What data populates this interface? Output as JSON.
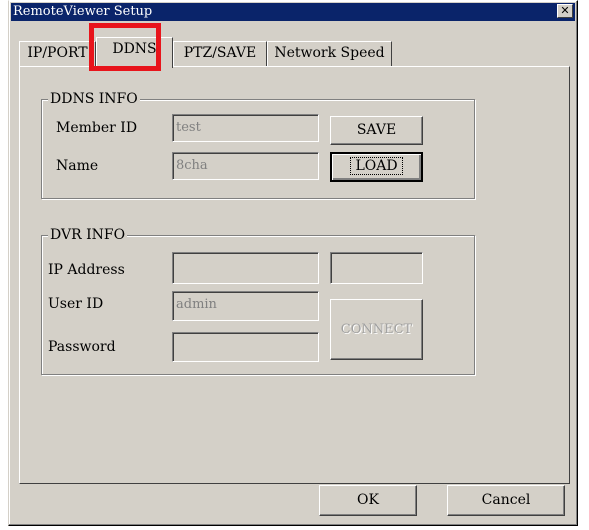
{
  "window": {
    "title": "RemoteViewer Setup",
    "close_symbol": "✕"
  },
  "tabs": [
    {
      "label": "IP/PORT",
      "active": false
    },
    {
      "label": "DDNS",
      "active": true
    },
    {
      "label": "PTZ/SAVE",
      "active": false
    },
    {
      "label": "Network Speed",
      "active": false
    }
  ],
  "ddns_info": {
    "title": "DDNS INFO",
    "member_id_label": "Member ID",
    "member_id_value": "test",
    "name_label": "Name",
    "name_value": "8cha",
    "save_label": "SAVE",
    "load_label": "LOAD"
  },
  "dvr_info": {
    "title": "DVR INFO",
    "ip_label": "IP Address",
    "ip_value": "",
    "port_value": "",
    "user_label": "User ID",
    "user_value": "admin",
    "password_label": "Password",
    "password_value": "",
    "connect_label": "CONNECT"
  },
  "footer": {
    "ok_label": "OK",
    "cancel_label": "Cancel"
  },
  "colors": {
    "highlight": "#e8141b",
    "titlebar": "#0a246a",
    "face": "#d4d0c8"
  }
}
